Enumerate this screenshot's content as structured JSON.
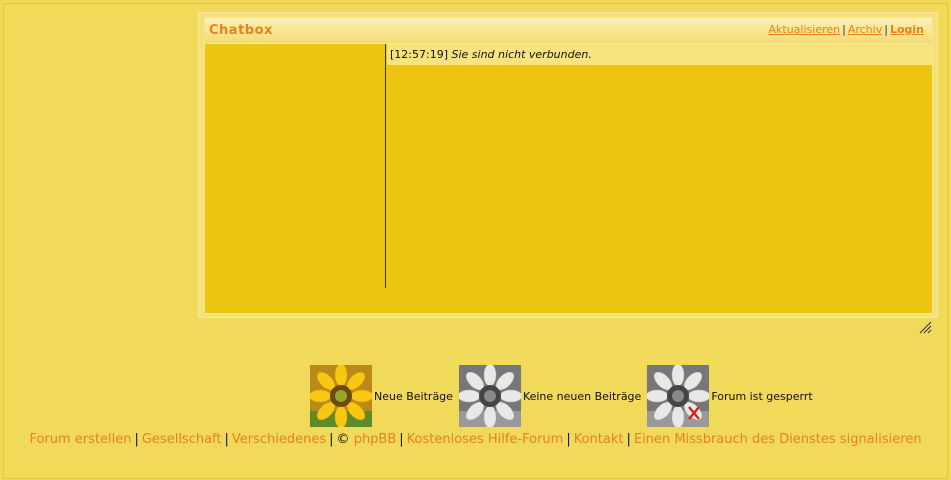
{
  "chatbox": {
    "title": "Chatbox",
    "links": {
      "refresh": "Aktualisieren",
      "archive": "Archiv",
      "login": "Login"
    },
    "message": {
      "time": "[12:57:19]",
      "text": "Sie sind nicht verbunden."
    }
  },
  "legend": [
    {
      "label": "Neue Beiträge",
      "icon": "sunflower-color-icon"
    },
    {
      "label": "Keine neuen Beiträge",
      "icon": "sunflower-grey-icon"
    },
    {
      "label": "Forum ist gesperrt",
      "icon": "sunflower-locked-icon"
    }
  ],
  "footer": {
    "forum_create": "Forum erstellen",
    "society": "Gesellschaft",
    "misc": "Verschiedenes",
    "copyright": "©",
    "phpbb": "phpBB",
    "help_forum": "Kostenloses Hilfe-Forum",
    "contact": "Kontakt",
    "report": "Einen Missbrauch des Dienstes signalisieren"
  },
  "colors": {
    "background": "#f0d858",
    "chat_area": "#ecc512",
    "link": "#e8821a"
  }
}
